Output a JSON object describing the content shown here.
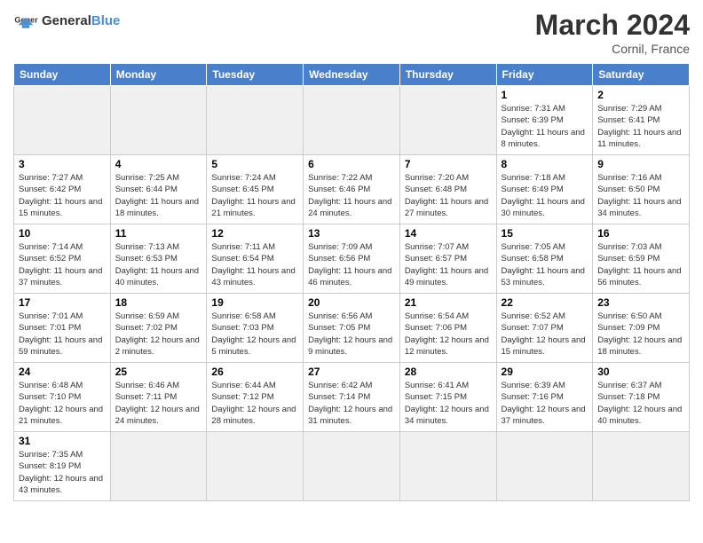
{
  "header": {
    "logo_general": "General",
    "logo_blue": "Blue",
    "title": "March 2024",
    "location": "Cornil, France"
  },
  "days_of_week": [
    "Sunday",
    "Monday",
    "Tuesday",
    "Wednesday",
    "Thursday",
    "Friday",
    "Saturday"
  ],
  "weeks": [
    [
      {
        "day": "",
        "info": ""
      },
      {
        "day": "",
        "info": ""
      },
      {
        "day": "",
        "info": ""
      },
      {
        "day": "",
        "info": ""
      },
      {
        "day": "",
        "info": ""
      },
      {
        "day": "1",
        "info": "Sunrise: 7:31 AM\nSunset: 6:39 PM\nDaylight: 11 hours\nand 8 minutes."
      },
      {
        "day": "2",
        "info": "Sunrise: 7:29 AM\nSunset: 6:41 PM\nDaylight: 11 hours\nand 11 minutes."
      }
    ],
    [
      {
        "day": "3",
        "info": "Sunrise: 7:27 AM\nSunset: 6:42 PM\nDaylight: 11 hours\nand 15 minutes."
      },
      {
        "day": "4",
        "info": "Sunrise: 7:25 AM\nSunset: 6:44 PM\nDaylight: 11 hours\nand 18 minutes."
      },
      {
        "day": "5",
        "info": "Sunrise: 7:24 AM\nSunset: 6:45 PM\nDaylight: 11 hours\nand 21 minutes."
      },
      {
        "day": "6",
        "info": "Sunrise: 7:22 AM\nSunset: 6:46 PM\nDaylight: 11 hours\nand 24 minutes."
      },
      {
        "day": "7",
        "info": "Sunrise: 7:20 AM\nSunset: 6:48 PM\nDaylight: 11 hours\nand 27 minutes."
      },
      {
        "day": "8",
        "info": "Sunrise: 7:18 AM\nSunset: 6:49 PM\nDaylight: 11 hours\nand 30 minutes."
      },
      {
        "day": "9",
        "info": "Sunrise: 7:16 AM\nSunset: 6:50 PM\nDaylight: 11 hours\nand 34 minutes."
      }
    ],
    [
      {
        "day": "10",
        "info": "Sunrise: 7:14 AM\nSunset: 6:52 PM\nDaylight: 11 hours\nand 37 minutes."
      },
      {
        "day": "11",
        "info": "Sunrise: 7:13 AM\nSunset: 6:53 PM\nDaylight: 11 hours\nand 40 minutes."
      },
      {
        "day": "12",
        "info": "Sunrise: 7:11 AM\nSunset: 6:54 PM\nDaylight: 11 hours\nand 43 minutes."
      },
      {
        "day": "13",
        "info": "Sunrise: 7:09 AM\nSunset: 6:56 PM\nDaylight: 11 hours\nand 46 minutes."
      },
      {
        "day": "14",
        "info": "Sunrise: 7:07 AM\nSunset: 6:57 PM\nDaylight: 11 hours\nand 49 minutes."
      },
      {
        "day": "15",
        "info": "Sunrise: 7:05 AM\nSunset: 6:58 PM\nDaylight: 11 hours\nand 53 minutes."
      },
      {
        "day": "16",
        "info": "Sunrise: 7:03 AM\nSunset: 6:59 PM\nDaylight: 11 hours\nand 56 minutes."
      }
    ],
    [
      {
        "day": "17",
        "info": "Sunrise: 7:01 AM\nSunset: 7:01 PM\nDaylight: 11 hours\nand 59 minutes."
      },
      {
        "day": "18",
        "info": "Sunrise: 6:59 AM\nSunset: 7:02 PM\nDaylight: 12 hours\nand 2 minutes."
      },
      {
        "day": "19",
        "info": "Sunrise: 6:58 AM\nSunset: 7:03 PM\nDaylight: 12 hours\nand 5 minutes."
      },
      {
        "day": "20",
        "info": "Sunrise: 6:56 AM\nSunset: 7:05 PM\nDaylight: 12 hours\nand 9 minutes."
      },
      {
        "day": "21",
        "info": "Sunrise: 6:54 AM\nSunset: 7:06 PM\nDaylight: 12 hours\nand 12 minutes."
      },
      {
        "day": "22",
        "info": "Sunrise: 6:52 AM\nSunset: 7:07 PM\nDaylight: 12 hours\nand 15 minutes."
      },
      {
        "day": "23",
        "info": "Sunrise: 6:50 AM\nSunset: 7:09 PM\nDaylight: 12 hours\nand 18 minutes."
      }
    ],
    [
      {
        "day": "24",
        "info": "Sunrise: 6:48 AM\nSunset: 7:10 PM\nDaylight: 12 hours\nand 21 minutes."
      },
      {
        "day": "25",
        "info": "Sunrise: 6:46 AM\nSunset: 7:11 PM\nDaylight: 12 hours\nand 24 minutes."
      },
      {
        "day": "26",
        "info": "Sunrise: 6:44 AM\nSunset: 7:12 PM\nDaylight: 12 hours\nand 28 minutes."
      },
      {
        "day": "27",
        "info": "Sunrise: 6:42 AM\nSunset: 7:14 PM\nDaylight: 12 hours\nand 31 minutes."
      },
      {
        "day": "28",
        "info": "Sunrise: 6:41 AM\nSunset: 7:15 PM\nDaylight: 12 hours\nand 34 minutes."
      },
      {
        "day": "29",
        "info": "Sunrise: 6:39 AM\nSunset: 7:16 PM\nDaylight: 12 hours\nand 37 minutes."
      },
      {
        "day": "30",
        "info": "Sunrise: 6:37 AM\nSunset: 7:18 PM\nDaylight: 12 hours\nand 40 minutes."
      }
    ],
    [
      {
        "day": "31",
        "info": "Sunrise: 7:35 AM\nSunset: 8:19 PM\nDaylight: 12 hours\nand 43 minutes."
      },
      {
        "day": "",
        "info": ""
      },
      {
        "day": "",
        "info": ""
      },
      {
        "day": "",
        "info": ""
      },
      {
        "day": "",
        "info": ""
      },
      {
        "day": "",
        "info": ""
      },
      {
        "day": "",
        "info": ""
      }
    ]
  ]
}
